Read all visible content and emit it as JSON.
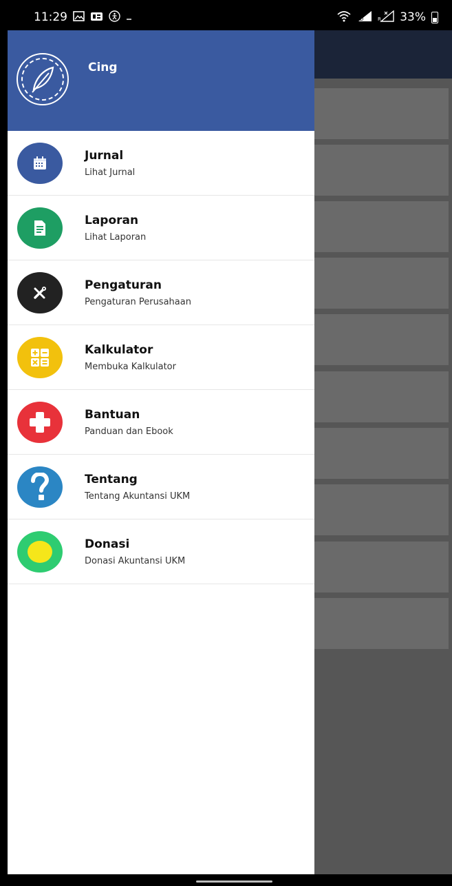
{
  "status_bar": {
    "time": "11:29",
    "battery": "33%",
    "left_icons": [
      "image-icon",
      "message-icon",
      "accessibility-icon",
      "dash-icon"
    ],
    "right_icons": [
      "wifi-icon",
      "signal-icon",
      "signal-x-icon",
      "battery-icon"
    ]
  },
  "drawer": {
    "header": {
      "name": "Cing",
      "avatar_icon": "feather-icon",
      "background": "#3a5aa0"
    },
    "items": [
      {
        "title": "Jurnal",
        "subtitle": "Lihat Jurnal",
        "icon": "calendar-icon",
        "color": "#3a5aa0"
      },
      {
        "title": "Laporan",
        "subtitle": "Lihat Laporan",
        "icon": "document-icon",
        "color": "#1e9e63"
      },
      {
        "title": "Pengaturan",
        "subtitle": "Pengaturan Perusahaan",
        "icon": "tools-icon",
        "color": "#222222"
      },
      {
        "title": "Kalkulator",
        "subtitle": "Membuka Kalkulator",
        "icon": "calculator-icon",
        "color": "#f2c10d"
      },
      {
        "title": "Bantuan",
        "subtitle": "Panduan dan Ebook",
        "icon": "plus-icon",
        "color": "#e8323a"
      },
      {
        "title": "Tentang",
        "subtitle": "Tentang Akuntansi UKM",
        "icon": "question-icon",
        "color": "#2b86c4"
      },
      {
        "title": "Donasi",
        "subtitle": "Donasi Akuntansi UKM",
        "icon": "coin-icon",
        "color": "#2ecc71"
      }
    ]
  },
  "colors": {
    "app_bar": "#1b2438",
    "scrim": "#565656",
    "card": "#6a6a6a"
  }
}
